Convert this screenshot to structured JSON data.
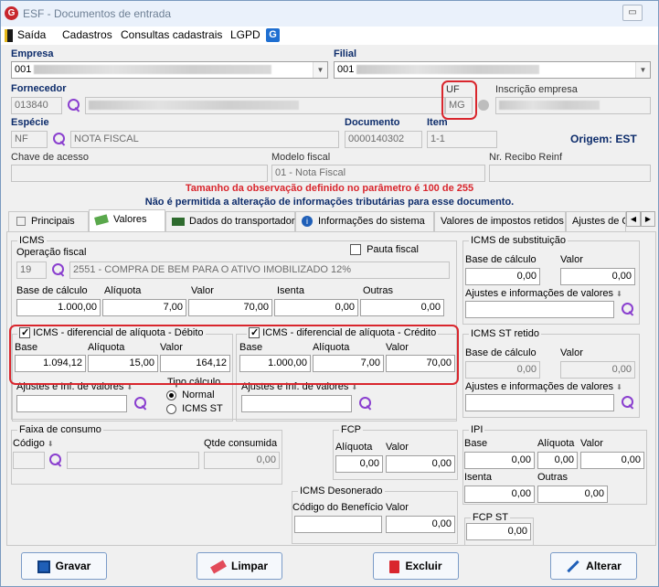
{
  "window": {
    "title": "ESF - Documentos de entrada",
    "app_icon": "G"
  },
  "menu": {
    "items": [
      "Saída",
      "Cadastros",
      "Consultas cadastrais",
      "LGPD"
    ]
  },
  "header": {
    "empresa_label": "Empresa",
    "empresa_value": "001",
    "filial_label": "Filial",
    "filial_value": "001",
    "fornecedor_label": "Fornecedor",
    "fornecedor_code": "013840",
    "uf_label": "UF",
    "uf_value": "MG",
    "inscricao_label": "Inscrição empresa",
    "especie_label": "Espécie",
    "especie_code": "NF",
    "especie_desc": "NOTA FISCAL",
    "documento_label": "Documento",
    "documento_value": "0000140302",
    "item_label": "Item",
    "item_value": "1-1",
    "origem": "Origem: EST",
    "chave_label": "Chave de acesso",
    "modelo_label": "Modelo fiscal",
    "modelo_value": "01 - Nota Fiscal",
    "recibo_label": "Nr. Recibo Reinf"
  },
  "messages": {
    "obs": "Tamanho da observação definido no parâmetro é 100 de 255",
    "warn": "Não é permitida a alteração de informações tributárias para esse documento."
  },
  "tabs": [
    "Principais",
    "Valores",
    "Dados do transportador",
    "Informações do sistema",
    "Valores de impostos retidos",
    "Ajustes de C"
  ],
  "icms": {
    "title": "ICMS",
    "pauta_label": "Pauta fiscal",
    "op_label": "Operação fiscal",
    "op_code": "19",
    "op_desc": "2551 - COMPRA DE BEM PARA O ATIVO IMOBILIZADO 12%",
    "base_label": "Base de cálculo",
    "aliq_label": "Alíquota",
    "valor_label": "Valor",
    "isenta_label": "Isenta",
    "outras_label": "Outras",
    "base": "1.000,00",
    "aliq": "7,00",
    "valor": "70,00",
    "isenta": "0,00",
    "outras": "0,00"
  },
  "difal_debito": {
    "title": "ICMS - diferencial de alíquota - Débito",
    "base_label": "Base",
    "aliq_label": "Alíquota",
    "valor_label": "Valor",
    "base": "1.094,12",
    "aliq": "15,00",
    "valor": "164,12",
    "ajustes_label": "Ajustes e Inf. de valores",
    "tipo_label": "Tipo cálculo",
    "opt_normal": "Normal",
    "opt_st": "ICMS ST"
  },
  "difal_credito": {
    "title": "ICMS - diferencial de alíquota - Crédito",
    "base_label": "Base",
    "aliq_label": "Alíquota",
    "valor_label": "Valor",
    "base": "1.000,00",
    "aliq": "7,00",
    "valor": "70,00",
    "ajustes_label": "Ajustes e Inf. de valores"
  },
  "subst": {
    "title": "ICMS de substituição",
    "base_label": "Base de cálculo",
    "valor_label": "Valor",
    "base": "0,00",
    "valor": "0,00",
    "ajustes_label": "Ajustes e informações de valores"
  },
  "st_retido": {
    "title": "ICMS ST retido",
    "base_label": "Base de cálculo",
    "valor_label": "Valor",
    "base": "0,00",
    "valor": "0,00",
    "ajustes_label": "Ajustes e informações de valores"
  },
  "faixa": {
    "title": "Faixa de consumo",
    "codigo_label": "Código",
    "qtde_label": "Qtde consumida",
    "qtde": "0,00"
  },
  "fcp": {
    "title": "FCP",
    "aliq_label": "Alíquota",
    "valor_label": "Valor",
    "aliq": "0,00",
    "valor": "0,00"
  },
  "ipi": {
    "title": "IPI",
    "base_label": "Base",
    "aliq_label": "Alíquota",
    "valor_label": "Valor",
    "base": "0,00",
    "aliq": "0,00",
    "valor": "0,00",
    "isenta_label": "Isenta",
    "outras_label": "Outras",
    "isenta": "0,00",
    "outras": "0,00"
  },
  "desonerado": {
    "title": "ICMS Desonerado",
    "cod_label": "Código do Benefício",
    "valor_label": "Valor",
    "valor": "0,00"
  },
  "fcp_st": {
    "title": "FCP ST",
    "valor": "0,00"
  },
  "buttons": {
    "gravar": "Gravar",
    "limpar": "Limpar",
    "excluir": "Excluir",
    "alterar": "Alterar"
  },
  "colors": {
    "label_blue": "#0d2c6b",
    "alert_red": "#d9262d",
    "highlight_red": "#d9262d"
  }
}
